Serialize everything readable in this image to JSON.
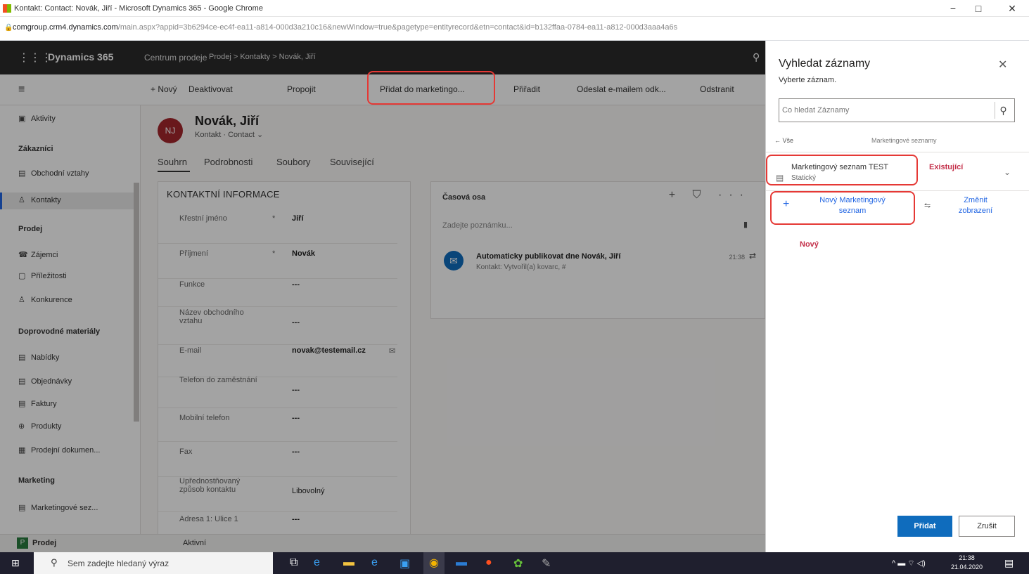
{
  "browser": {
    "tab_title": "Kontakt: Contact: Novák, Jiří - Microsoft Dynamics 365 - Google Chrome",
    "url_host": "comgroup.crm4.dynamics.com",
    "url_rest": "/main.aspx?appid=3b6294ce-ec4f-ea11-a814-000d3a210c16&newWindow=true&pagetype=entityrecord&etn=contact&id=b132ffaa-0784-ea11-a812-000d3aaa4a6s",
    "minimize": "−",
    "maximize": "□",
    "close": "✕"
  },
  "app": {
    "brand": "Dynamics 365",
    "app_name": "Centrum prodeje",
    "breadcrumb": "Prodej  >  Kontakty  >  Novák, Jiří",
    "commands": {
      "new": "+ Nový",
      "deactivate": "Deaktivovat",
      "connect": "Propojit",
      "add_marketing": "Přidat do marketingo...",
      "assign": "Přiřadit",
      "send_email": "Odeslat e-mailem odk...",
      "delete": "Odstranit"
    }
  },
  "sidebar": {
    "items": [
      {
        "label": "Aktivity",
        "icon": "activity-icon"
      },
      {
        "group": "Zákazníci"
      },
      {
        "label": "Obchodní vztahy",
        "icon": "accounts-icon"
      },
      {
        "label": "Kontakty",
        "icon": "contact-icon"
      },
      {
        "group": "Prodej"
      },
      {
        "label": "Zájemci",
        "icon": "leads-icon"
      },
      {
        "label": "Příležitosti",
        "icon": "opportunity-icon"
      },
      {
        "label": "Konkurence",
        "icon": "competitor-icon"
      },
      {
        "group": "Doprovodné materiály"
      },
      {
        "label": "Nabídky",
        "icon": "quote-icon"
      },
      {
        "label": "Objednávky",
        "icon": "order-icon"
      },
      {
        "label": "Faktury",
        "icon": "invoice-icon"
      },
      {
        "label": "Produkty",
        "icon": "product-icon"
      },
      {
        "label": "Prodejní dokumen...",
        "icon": "document-icon"
      },
      {
        "group": "Marketing"
      },
      {
        "label": "Marketingové sez...",
        "icon": "list-icon"
      }
    ],
    "area_badge": "P",
    "area_label": "Prodej"
  },
  "record": {
    "initials": "NJ",
    "name": "Novák, Jiří",
    "type": "Kontakt · Contact ⌄",
    "tabs": [
      "Souhrn",
      "Podrobnosti",
      "Soubory",
      "Související"
    ],
    "section_title": "KONTAKTNÍ INFORMACE",
    "fields": [
      {
        "label": "Křestní jméno",
        "req": "*",
        "value": "Jiří"
      },
      {
        "label": "Příjmení",
        "req": "*",
        "value": "Novák"
      },
      {
        "label": "Funkce",
        "req": "",
        "value": "---"
      },
      {
        "label": "Název obchodního vztahu",
        "req": "",
        "value": "---"
      },
      {
        "label": "E-mail",
        "req": "",
        "value": "novak@testemail.cz"
      },
      {
        "label": "Telefon do zaměstnání",
        "req": "",
        "value": "---"
      },
      {
        "label": "Mobilní telefon",
        "req": "",
        "value": "---"
      },
      {
        "label": "Fax",
        "req": "",
        "value": "---"
      },
      {
        "label": "Upřednostňovaný způsob kontaktu",
        "req": "",
        "value": "Libovolný"
      },
      {
        "label": "Adresa 1: Ulice 1",
        "req": "",
        "value": "---"
      }
    ],
    "timeline": {
      "title": "Časová osa",
      "note_placeholder": "Zadejte poznámku...",
      "entry_title": "Automaticky publikovat dne Novák, Jiří",
      "entry_sub": "Kontakt: Vytvořil(a) kovarc, #",
      "entry_time": "21:38"
    }
  },
  "status_bar": "Aktivní",
  "panel": {
    "title": "Vyhledat záznamy",
    "subtitle": "Vyberte záznam.",
    "search_placeholder": "Co hledat Záznamy",
    "back": "← Vše",
    "category": "Marketingové seznamy",
    "record_name": "Marketingový seznam TEST",
    "record_status": "Statický",
    "existing": "Existující",
    "new_record": "Nový Marketingový seznam",
    "change_view": "Změnit zobrazení",
    "new_label": "Nový",
    "add_button": "Přidat",
    "cancel_button": "Zrušit"
  },
  "taskbar": {
    "search_placeholder": "Sem zadejte hledaný výraz",
    "time": "21:38",
    "date": "21.04.2020"
  },
  "colors": {
    "accent": "#0f6cbd",
    "highlight_red": "#e53935",
    "existing_red": "#c4314b"
  }
}
